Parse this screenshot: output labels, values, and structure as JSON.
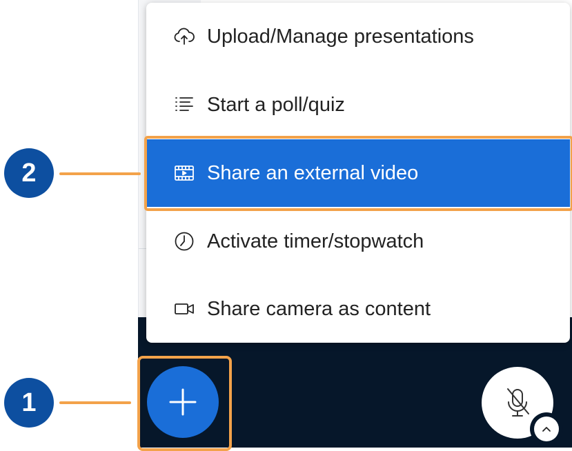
{
  "menu": {
    "items": [
      {
        "label": "Upload/Manage presentations",
        "icon": "cloud-upload-icon"
      },
      {
        "label": "Start a poll/quiz",
        "icon": "list-icon"
      },
      {
        "label": "Share an external video",
        "icon": "film-icon",
        "active": true
      },
      {
        "label": "Activate timer/stopwatch",
        "icon": "clock-icon"
      },
      {
        "label": "Share camera as content",
        "icon": "video-camera-icon"
      }
    ]
  },
  "callouts": {
    "one": "1",
    "two": "2"
  },
  "colors": {
    "accent": "#1a6ed8",
    "highlight": "#f3a24a",
    "callout": "#0d4fa0",
    "toolbar_bg": "#06172a"
  },
  "buttons": {
    "actions_icon": "plus-icon",
    "mic_icon": "microphone-muted-icon",
    "mic_options_icon": "chevron-up-icon"
  }
}
